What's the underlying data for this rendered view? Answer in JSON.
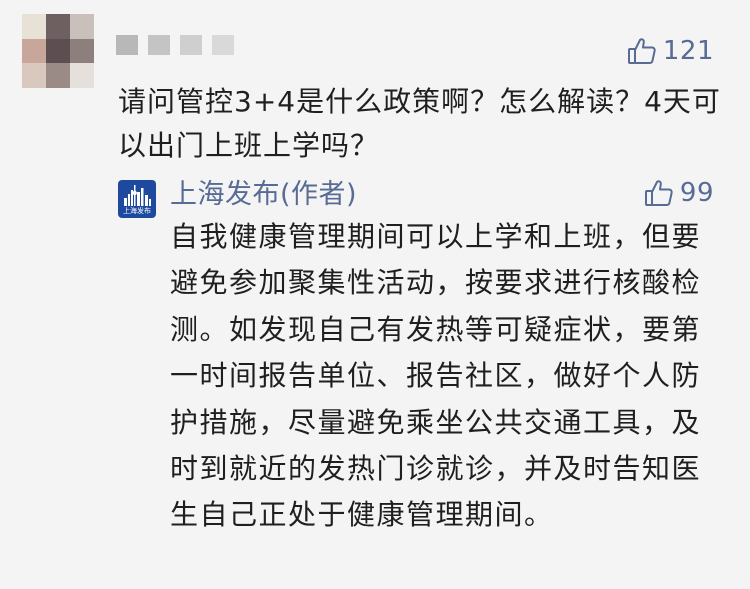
{
  "comment": {
    "text": "请问管控3+4是什么政策啊？怎么解读？4天可以出门上班上学吗？",
    "like_icon": "thumbs-up-icon",
    "like_count": "121"
  },
  "reply": {
    "author": "上海发布(作者)",
    "logo_text": "上海发布",
    "like_icon": "thumbs-up-icon",
    "like_count": "99",
    "text": "自我健康管理期间可以上学和上班，但要避免参加聚集性活动，按要求进行核酸检测。如发现自己有发热等可疑症状，要第一时间报告单位、报告社区，做好个人防护措施，尽量避免乘坐公共交通工具，及时到就近的发热门诊就诊，并及时告知医生自己正处于健康管理期间。"
  },
  "colors": {
    "background": "#f4f4f4",
    "link_blue": "#576b95",
    "text": "#1f1f1f",
    "logo_blue": "#1d4a9f"
  }
}
